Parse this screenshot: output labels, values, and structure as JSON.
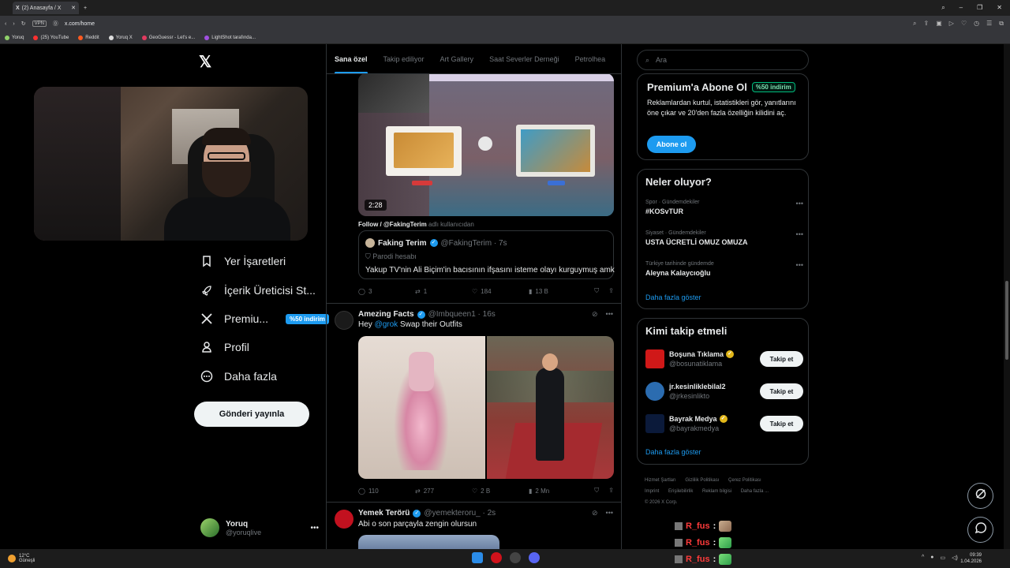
{
  "browser": {
    "tab_title": "(2) Anasayfa / X",
    "url_badge": "VPN",
    "url": "x.com/home",
    "bookmarks": [
      "Yoruq",
      "(25) YouTube",
      "Reddit",
      "Yoruq X",
      "GeoGuessr - Let's e...",
      "LightShot tarafında..."
    ]
  },
  "nav": {
    "items": [
      {
        "label": "Yer İşaretleri",
        "icon": "bookmark-icon"
      },
      {
        "label": "İçerik Üreticisi St...",
        "icon": "rocket-icon"
      },
      {
        "label": "Premiu...",
        "icon": "x-logo-icon",
        "badge": "%50 indirim"
      },
      {
        "label": "Profil",
        "icon": "person-icon"
      },
      {
        "label": "Daha fazla",
        "icon": "more-circle-icon"
      }
    ],
    "post_button": "Gönderi yayınla",
    "profile": {
      "name": "Yoruq",
      "handle": "@yoruqlive"
    }
  },
  "feed": {
    "tabs": [
      "Sana özel",
      "Takip ediliyor",
      "Art Gallery",
      "Saat Severler Derneği",
      "Petrolhea"
    ],
    "post1": {
      "video_duration": "2:28",
      "follow_line": "Follow / @FakingTerim",
      "follow_line_dim": "adlı kullanıcıdan",
      "quote": {
        "name": "Faking Terim",
        "handle": "@FakingTerim · 7s",
        "label": "Parodi hesabı",
        "text": "Yakup TV'nin Ali Biçim'in bacısının ifşasını isteme olayı kurguymuş amk"
      },
      "stats": {
        "replies": "3",
        "reposts": "1",
        "likes": "184",
        "views": "13 B"
      }
    },
    "post2": {
      "name": "Amezing Facts",
      "handle": "@Imbqueen1 · 16s",
      "text_prefix": "Hey ",
      "mention": "@grok",
      "text_suffix": " Swap their Outfits",
      "stats": {
        "replies": "110",
        "reposts": "277",
        "likes": "2 B",
        "views": "2 Mn"
      }
    },
    "post3": {
      "name": "Yemek Terörü",
      "handle": "@yemekteroru_ · 2s",
      "text": "Abi o son parçayla zengin olursun"
    }
  },
  "sidebar": {
    "search_placeholder": "Ara",
    "premium": {
      "title": "Premium'a Abone Ol",
      "discount": "%50 indirim",
      "desc": "Reklamlardan kurtul, istatistikleri gör, yanıtlarını öne çıkar ve 20'den fazla özelliğin kilidini aç.",
      "button": "Abone ol"
    },
    "trends": {
      "title": "Neler oluyor?",
      "items": [
        {
          "context": "Spor · Gündemdekiler",
          "name": "#KOSvTUR"
        },
        {
          "context": "Siyaset · Gündemdekiler",
          "name": "USTA ÜCRETLİ OMUZ OMUZA"
        },
        {
          "context": "Türkiye tarihinde gündemde",
          "name": "Aleyna Kalaycıoğlu"
        }
      ],
      "show_more": "Daha fazla göster"
    },
    "who_to_follow": {
      "title": "Kimi takip etmeli",
      "items": [
        {
          "name": "Boşuna Tıklama",
          "handle": "@bosunatiklama",
          "button": "Takip et"
        },
        {
          "name": "jr.kesinliklebilal2",
          "handle": "@jrkesinlikto",
          "button": "Takip et"
        },
        {
          "name": "Bayrak Medya",
          "handle": "@bayrakmedya",
          "button": "Takip et"
        }
      ],
      "show_more": "Daha fazla göster"
    },
    "footer": [
      "Hizmet Şartları",
      "Gizlilik Politikası",
      "Çerez Politikası",
      "Imprint",
      "Erişilebilirlik",
      "Reklam bilgisi",
      "Daha fazla ...",
      "© 2026 X Corp."
    ]
  },
  "chat": [
    {
      "user": "R_fus",
      "sep": ":"
    },
    {
      "user": "R_fus",
      "sep": ":"
    },
    {
      "user": "R_fus",
      "sep": ":"
    }
  ],
  "taskbar": {
    "temp": "12°C",
    "weather": "Güneşli",
    "time": "09:39",
    "date": "1.04.2026"
  }
}
